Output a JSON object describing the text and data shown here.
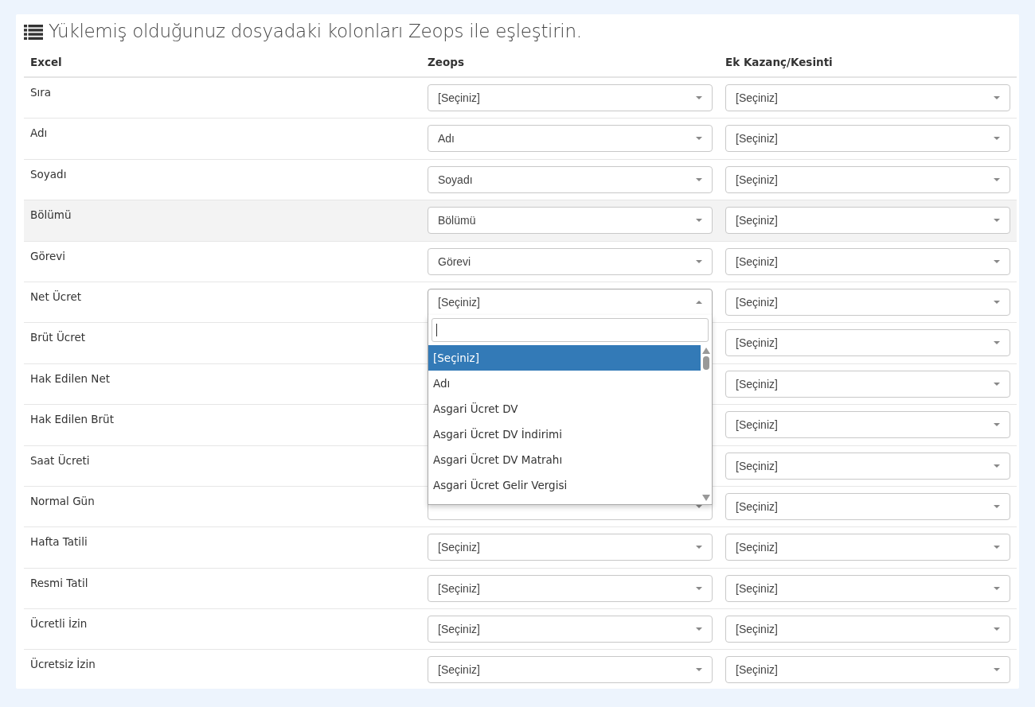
{
  "title": "Yüklemiş olduğunuz dosyadaki kolonları Zeops ile eşleştirin.",
  "columns": [
    "Excel",
    "Zeops",
    "Ek Kazanç/Kesinti"
  ],
  "rows": [
    {
      "excel": "Sıra",
      "highlighted": false,
      "zeops": {
        "value": "[Seçiniz]",
        "open": false
      },
      "extra": {
        "value": "[Seçiniz]"
      }
    },
    {
      "excel": "Adı",
      "highlighted": false,
      "zeops": {
        "value": "Adı",
        "open": false
      },
      "extra": {
        "value": "[Seçiniz]"
      }
    },
    {
      "excel": "Soyadı",
      "highlighted": false,
      "zeops": {
        "value": "Soyadı",
        "open": false
      },
      "extra": {
        "value": "[Seçiniz]"
      }
    },
    {
      "excel": "Bölümü",
      "highlighted": true,
      "zeops": {
        "value": "Bölümü",
        "open": false
      },
      "extra": {
        "value": "[Seçiniz]"
      }
    },
    {
      "excel": "Görevi",
      "highlighted": false,
      "zeops": {
        "value": "Görevi",
        "open": false
      },
      "extra": {
        "value": "[Seçiniz]"
      }
    },
    {
      "excel": "Net Ücret",
      "highlighted": false,
      "zeops": {
        "value": "[Seçiniz]",
        "open": true,
        "options": [
          {
            "label": "[Seçiniz]",
            "selected": true
          },
          {
            "label": "Adı",
            "selected": false
          },
          {
            "label": "Asgari Ücret DV",
            "selected": false
          },
          {
            "label": "Asgari Ücret DV İndirimi",
            "selected": false
          },
          {
            "label": "Asgari Ücret DV Matrahı",
            "selected": false
          },
          {
            "label": "Asgari Ücret Gelir Vergisi",
            "selected": false
          }
        ]
      },
      "extra": {
        "value": "[Seçiniz]"
      }
    },
    {
      "excel": "Brüt Ücret",
      "highlighted": false,
      "zeops": {},
      "extra": {
        "value": "[Seçiniz]"
      }
    },
    {
      "excel": "Hak Edilen Net",
      "highlighted": false,
      "zeops": {},
      "extra": {
        "value": "[Seçiniz]"
      }
    },
    {
      "excel": "Hak Edilen Brüt",
      "highlighted": false,
      "zeops": {},
      "extra": {
        "value": "[Seçiniz]"
      }
    },
    {
      "excel": "Saat Ücreti",
      "highlighted": false,
      "zeops": {},
      "extra": {
        "value": "[Seçiniz]"
      }
    },
    {
      "excel": "Normal Gün",
      "highlighted": false,
      "zeops": {},
      "extra": {
        "value": "[Seçiniz]"
      }
    },
    {
      "excel": "Hafta Tatili",
      "highlighted": false,
      "zeops": {
        "value": "[Seçiniz]",
        "open": false
      },
      "extra": {
        "value": "[Seçiniz]"
      }
    },
    {
      "excel": "Resmi Tatil",
      "highlighted": false,
      "zeops": {
        "value": "[Seçiniz]",
        "open": false
      },
      "extra": {
        "value": "[Seçiniz]"
      }
    },
    {
      "excel": "Ücretli İzin",
      "highlighted": false,
      "zeops": {
        "value": "[Seçiniz]",
        "open": false
      },
      "extra": {
        "value": "[Seçiniz]"
      }
    },
    {
      "excel": "Ücretsiz İzin",
      "highlighted": false,
      "zeops": {
        "value": "[Seçiniz]",
        "open": false
      },
      "extra": {
        "value": "[Seçiniz]"
      }
    }
  ]
}
